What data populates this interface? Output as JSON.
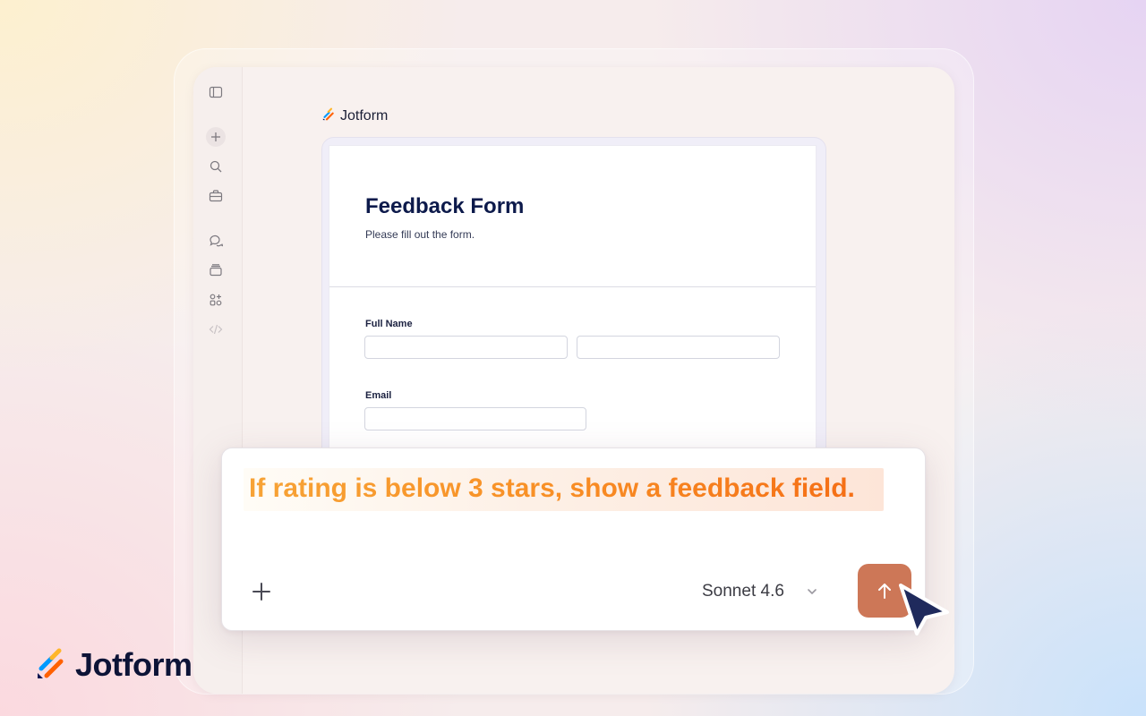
{
  "app": {
    "brand": "Jotform"
  },
  "form": {
    "title": "Feedback Form",
    "subtitle": "Please fill out the form.",
    "fields": {
      "full_name_label": "Full Name",
      "email_label": "Email"
    }
  },
  "sidebar": {
    "items": [
      {
        "icon": "sidebar-toggle-icon"
      },
      {
        "icon": "plus-icon"
      },
      {
        "icon": "search-icon"
      },
      {
        "icon": "briefcase-icon"
      },
      {
        "icon": "chat-icon"
      },
      {
        "icon": "archive-icon"
      },
      {
        "icon": "apps-icon"
      },
      {
        "icon": "code-icon"
      }
    ]
  },
  "prompt": {
    "text": "If rating is below 3 stars, show a feedback field.",
    "model": "Sonnet 4.6"
  },
  "colors": {
    "send_button": "#cd7757",
    "prompt_text_start": "#f7a336",
    "prompt_text_end": "#f56f16",
    "brand_navy": "#0d1437",
    "cursor": "#1f2a5c"
  }
}
